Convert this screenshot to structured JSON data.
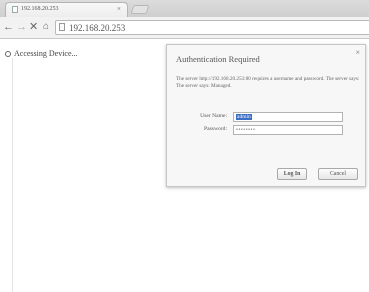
{
  "browser": {
    "tab_title": "192.168.20.253",
    "tab_close": "×",
    "url": "192.168.20.253",
    "nav": {
      "back": "←",
      "forward": "→",
      "stop": "✕",
      "home": "⌂"
    }
  },
  "page": {
    "status_text": "Accessing Device..."
  },
  "dialog": {
    "title": "Authentication Required",
    "close": "×",
    "message": "The server http://192.168.20.253:80 requires a username and password. The server says: The server says: Managed.",
    "username_label": "User Name:",
    "username_value": "admin",
    "password_label": "Password:",
    "password_value": "••••••••",
    "login_button": "Log In",
    "cancel_button": "Cancel"
  }
}
